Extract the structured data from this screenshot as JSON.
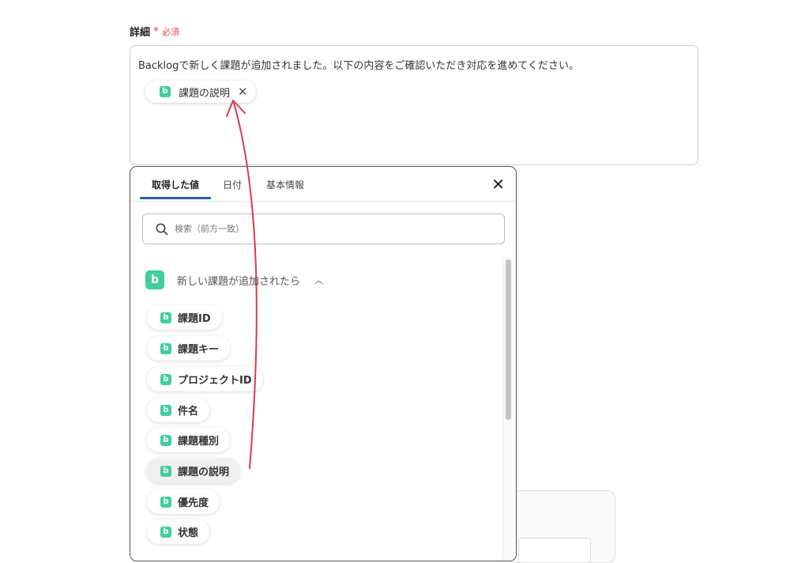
{
  "field": {
    "label": "詳細",
    "required_star": "*",
    "required_text": "必須"
  },
  "textarea": {
    "text": "Backlogで新しく課題が追加されました。以下の内容をご確認いただき対応を進めてください。",
    "chip_label": "課題の説明",
    "chip_icon": "b"
  },
  "panel": {
    "tabs": [
      "取得した値",
      "日付",
      "基本情報"
    ],
    "active_tab": "取得した値",
    "search_placeholder": "検索（前方一致）",
    "section": {
      "title": "新しい課題が追加されたら",
      "icon": "b",
      "expanded": true
    },
    "items": [
      "課題ID",
      "課題キー",
      "プロジェクトID",
      "件名",
      "課題種別",
      "課題の説明",
      "優先度",
      "状態"
    ],
    "hovered_item": "課題の説明"
  },
  "colors": {
    "backlog_green": "#42ce9f",
    "required_red": "#e0485a",
    "tab_underline": "#2f5e8f",
    "arrow_red": "#d43d4f"
  }
}
